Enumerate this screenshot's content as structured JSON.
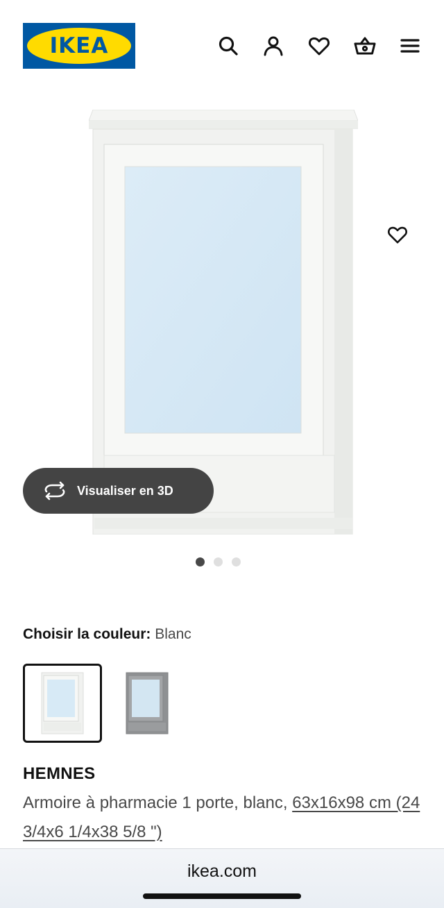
{
  "header": {
    "logo_text": "IKEA",
    "brand_blue": "#0058a3",
    "brand_yellow": "#ffdb00",
    "icons": [
      "search-icon",
      "account-icon",
      "heart-icon",
      "basket-icon",
      "menu-icon"
    ]
  },
  "gallery": {
    "button_3d_label": "Visualiser en 3D",
    "image_count": 3,
    "active_image": 1,
    "favorite_icon": "heart-icon"
  },
  "color": {
    "label": "Choisir la couleur:",
    "value": "Blanc",
    "options": [
      "white-cabinet",
      "grey-cabinet"
    ],
    "selected_index": 0
  },
  "product": {
    "name": "HEMNES",
    "description": "Armoire à pharmacie 1 porte, blanc,",
    "dimensions": "63x16x98 cm (24 3/4x6 1/4x38 5/8 \")"
  },
  "browser": {
    "url": "ikea.com"
  }
}
